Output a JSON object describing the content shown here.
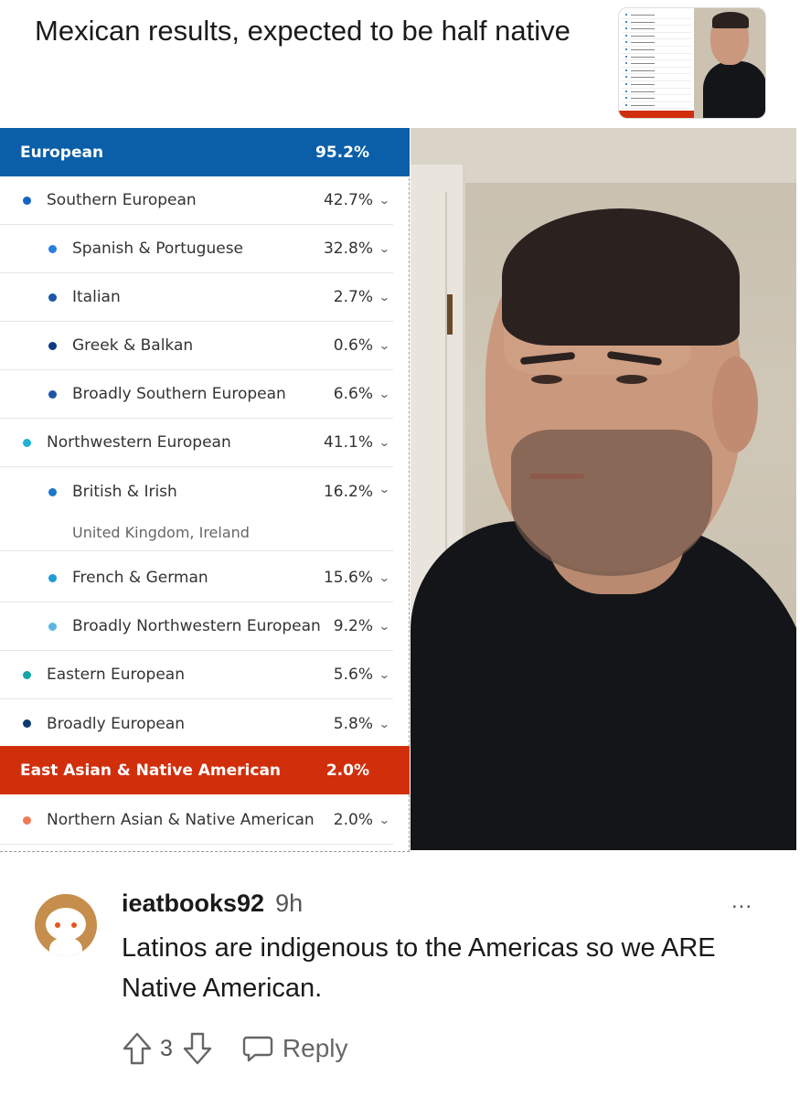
{
  "post": {
    "title": "Mexican results, expected to be half native"
  },
  "ancestry": {
    "groups": [
      {
        "label": "European",
        "pct": "95.2%",
        "color": "#0b5fa8"
      },
      {
        "label": "East Asian & Native American",
        "pct": "2.0%",
        "color": "#d12f0c"
      }
    ],
    "rows": [
      {
        "label": "Southern European",
        "pct": "42.7%",
        "level": 1,
        "dot": "#1565c0"
      },
      {
        "label": "Spanish & Portuguese",
        "pct": "32.8%",
        "level": 2,
        "dot": "#2b7de0"
      },
      {
        "label": "Italian",
        "pct": "2.7%",
        "level": 2,
        "dot": "#1c55a8"
      },
      {
        "label": "Greek & Balkan",
        "pct": "0.6%",
        "level": 2,
        "dot": "#0d3a86"
      },
      {
        "label": "Broadly Southern European",
        "pct": "6.6%",
        "level": 2,
        "dot": "#1c55a8"
      },
      {
        "label": "Northwestern European",
        "pct": "41.1%",
        "level": 1,
        "dot": "#1fb0d8"
      },
      {
        "label": "British & Irish",
        "pct": "16.2%",
        "level": 2,
        "dot": "#1a78c8",
        "note": "United Kingdom, Ireland"
      },
      {
        "label": "French & German",
        "pct": "15.6%",
        "level": 2,
        "dot": "#1f9bd8"
      },
      {
        "label": "Broadly Northwestern European",
        "pct": "9.2%",
        "level": 2,
        "dot": "#5bb7e0"
      },
      {
        "label": "Eastern European",
        "pct": "5.6%",
        "level": 1,
        "dot": "#13a6a6"
      },
      {
        "label": "Broadly European",
        "pct": "5.8%",
        "level": 1,
        "dot": "#0d3a6e"
      },
      {
        "label": "Northern Asian & Native American",
        "pct": "2.0%",
        "level": 1,
        "dot": "#f07a55"
      }
    ]
  },
  "comment": {
    "username": "ieatbooks92",
    "time": "9h",
    "body": "Latinos are indigenous to the Americas so we ARE Native American.",
    "votes": "3",
    "reply_label": "Reply",
    "more_label": "..."
  }
}
